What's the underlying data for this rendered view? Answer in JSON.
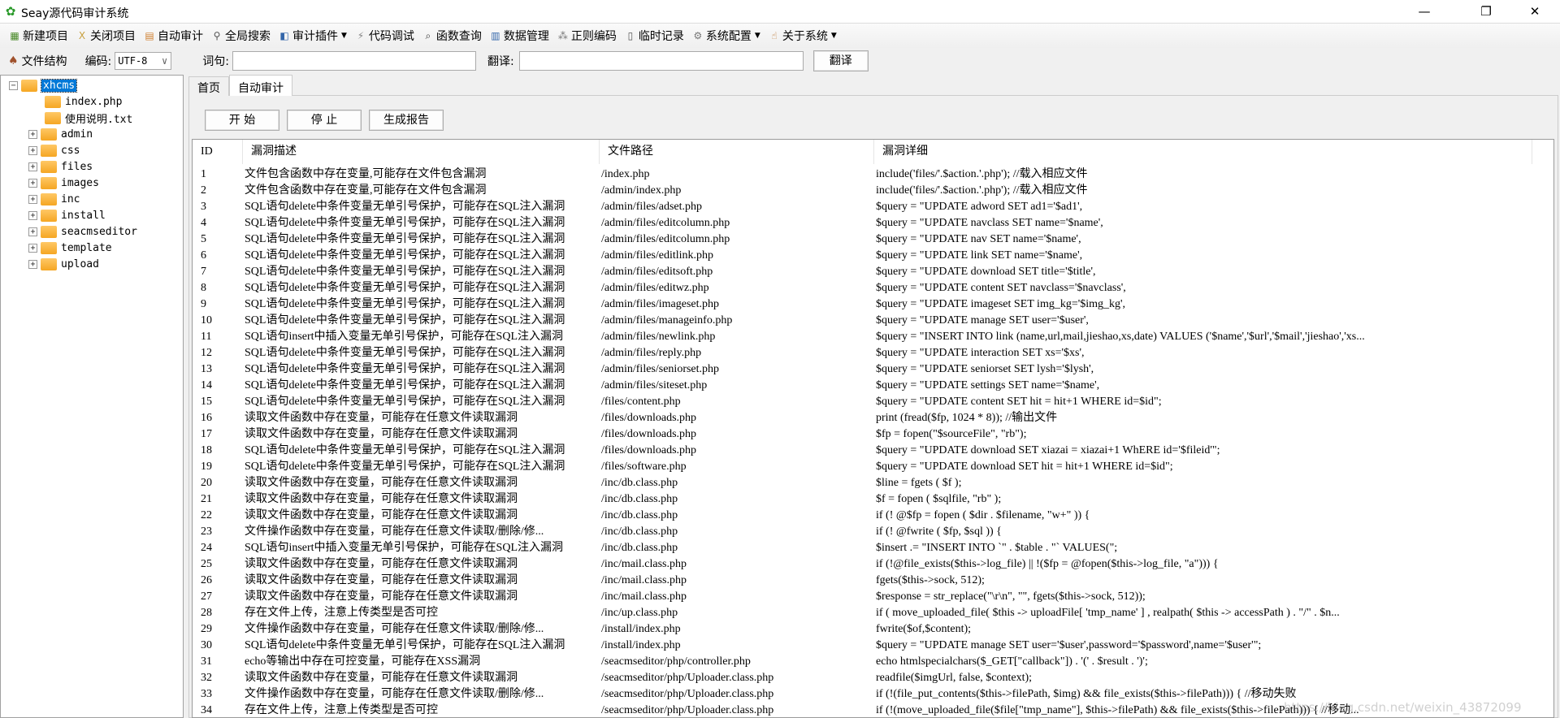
{
  "window": {
    "title": "Seay源代码审计系统",
    "minimize": "—",
    "restore": "❐",
    "close": "✕"
  },
  "toolbar": [
    {
      "label": "新建项目",
      "icon": "new-project-icon",
      "glyph": "▦",
      "color": "#4a8a2a"
    },
    {
      "label": "关闭项目",
      "icon": "close-project-icon",
      "glyph": "X",
      "color": "#c8a040"
    },
    {
      "label": "自动审计",
      "icon": "auto-audit-icon",
      "glyph": "▤",
      "color": "#d08030"
    },
    {
      "label": "全局搜索",
      "icon": "search-icon",
      "glyph": "⚲",
      "color": "#555"
    },
    {
      "label": "审计插件",
      "icon": "plugin-icon",
      "glyph": "◧",
      "color": "#3366aa",
      "dropdown": true
    },
    {
      "label": "代码调试",
      "icon": "debug-icon",
      "glyph": "⚡",
      "color": "#888"
    },
    {
      "label": "函数查询",
      "icon": "function-search-icon",
      "glyph": "⌕",
      "color": "#333"
    },
    {
      "label": "数据管理",
      "icon": "database-icon",
      "glyph": "▥",
      "color": "#3366aa"
    },
    {
      "label": "正则编码",
      "icon": "regex-icon",
      "glyph": "⁂",
      "color": "#777"
    },
    {
      "label": "临时记录",
      "icon": "notes-icon",
      "glyph": "▯",
      "color": "#555"
    },
    {
      "label": "系统配置",
      "icon": "gear-icon",
      "glyph": "⚙",
      "color": "#777",
      "dropdown": true
    },
    {
      "label": "关于系统",
      "icon": "about-icon",
      "glyph": "☝",
      "color": "#c08040",
      "dropdown": true
    }
  ],
  "toolbar2": {
    "file_structure": "文件结构",
    "encoding_label": "编码:",
    "encoding_value": "UTF-8",
    "word_label": "词句:",
    "word_value": "",
    "translate_label": "翻译:",
    "translate_value": "",
    "translate_button": "翻译"
  },
  "tree": {
    "root": "xhcms",
    "files": [
      "index.php",
      "使用说明.txt"
    ],
    "folders": [
      "admin",
      "css",
      "files",
      "images",
      "inc",
      "install",
      "seacmseditor",
      "template",
      "upload"
    ]
  },
  "tabs": [
    {
      "label": "首页",
      "active": false
    },
    {
      "label": "自动审计",
      "active": true
    }
  ],
  "buttons": {
    "start": "开 始",
    "stop": "停 止",
    "report": "生成报告"
  },
  "table": {
    "columns": [
      "ID",
      "漏洞描述",
      "文件路径",
      "漏洞详细"
    ],
    "rows": [
      [
        "1",
        "文件包含函数中存在变量,可能存在文件包含漏洞",
        "/index.php",
        "include('files/'.$action.'.php'); //载入相应文件"
      ],
      [
        "2",
        "文件包含函数中存在变量,可能存在文件包含漏洞",
        "/admin/index.php",
        "include('files/'.$action.'.php'); //载入相应文件"
      ],
      [
        "3",
        "SQL语句delete中条件变量无单引号保护，可能存在SQL注入漏洞",
        "/admin/files/adset.php",
        "$query = \"UPDATE adword SET ad1='$ad1',"
      ],
      [
        "4",
        "SQL语句delete中条件变量无单引号保护，可能存在SQL注入漏洞",
        "/admin/files/editcolumn.php",
        "$query = \"UPDATE navclass SET name='$name',"
      ],
      [
        "5",
        "SQL语句delete中条件变量无单引号保护，可能存在SQL注入漏洞",
        "/admin/files/editcolumn.php",
        "$query = \"UPDATE nav SET name='$name',"
      ],
      [
        "6",
        "SQL语句delete中条件变量无单引号保护，可能存在SQL注入漏洞",
        "/admin/files/editlink.php",
        "$query = \"UPDATE link SET name='$name',"
      ],
      [
        "7",
        "SQL语句delete中条件变量无单引号保护，可能存在SQL注入漏洞",
        "/admin/files/editsoft.php",
        "$query = \"UPDATE download SET title='$title',"
      ],
      [
        "8",
        "SQL语句delete中条件变量无单引号保护，可能存在SQL注入漏洞",
        "/admin/files/editwz.php",
        "$query = \"UPDATE content SET navclass='$navclass',"
      ],
      [
        "9",
        "SQL语句delete中条件变量无单引号保护，可能存在SQL注入漏洞",
        "/admin/files/imageset.php",
        "$query = \"UPDATE imageset SET img_kg='$img_kg',"
      ],
      [
        "10",
        "SQL语句delete中条件变量无单引号保护，可能存在SQL注入漏洞",
        "/admin/files/manageinfo.php",
        "$query = \"UPDATE manage SET user='$user',"
      ],
      [
        "11",
        "SQL语句insert中插入变量无单引号保护，可能存在SQL注入漏洞",
        "/admin/files/newlink.php",
        "$query = \"INSERT INTO link (name,url,mail,jieshao,xs,date) VALUES ('$name','$url','$mail','jieshao','xs..."
      ],
      [
        "12",
        "SQL语句delete中条件变量无单引号保护，可能存在SQL注入漏洞",
        "/admin/files/reply.php",
        "$query = \"UPDATE interaction SET xs='$xs',"
      ],
      [
        "13",
        "SQL语句delete中条件变量无单引号保护，可能存在SQL注入漏洞",
        "/admin/files/seniorset.php",
        "$query = \"UPDATE seniorset SET lysh='$lysh',"
      ],
      [
        "14",
        "SQL语句delete中条件变量无单引号保护，可能存在SQL注入漏洞",
        "/admin/files/siteset.php",
        "$query = \"UPDATE settings SET name='$name',"
      ],
      [
        "15",
        "SQL语句delete中条件变量无单引号保护，可能存在SQL注入漏洞",
        "/files/content.php",
        "$query = \"UPDATE content SET hit = hit+1 WHERE id=$id\";"
      ],
      [
        "16",
        "读取文件函数中存在变量，可能存在任意文件读取漏洞",
        "/files/downloads.php",
        "print (fread($fp, 1024 * 8)); //输出文件"
      ],
      [
        "17",
        "读取文件函数中存在变量，可能存在任意文件读取漏洞",
        "/files/downloads.php",
        "$fp = fopen(\"$sourceFile\", \"rb\");"
      ],
      [
        "18",
        "SQL语句delete中条件变量无单引号保护，可能存在SQL注入漏洞",
        "/files/downloads.php",
        "$query = \"UPDATE download SET xiazai = xiazai+1 WhERE id='$fileid'\";"
      ],
      [
        "19",
        "SQL语句delete中条件变量无单引号保护，可能存在SQL注入漏洞",
        "/files/software.php",
        "$query = \"UPDATE download SET hit = hit+1 WHERE id=$id\";"
      ],
      [
        "20",
        "读取文件函数中存在变量，可能存在任意文件读取漏洞",
        "/inc/db.class.php",
        "$line = fgets ( $f );"
      ],
      [
        "21",
        "读取文件函数中存在变量，可能存在任意文件读取漏洞",
        "/inc/db.class.php",
        "$f = fopen ( $sqlfile, \"rb\" );"
      ],
      [
        "22",
        "读取文件函数中存在变量，可能存在任意文件读取漏洞",
        "/inc/db.class.php",
        "if (! @$fp = fopen ( $dir . $filename, \"w+\" )) {"
      ],
      [
        "23",
        "文件操作函数中存在变量，可能存在任意文件读取/删除/修...",
        "/inc/db.class.php",
        "if (! @fwrite ( $fp, $sql )) {"
      ],
      [
        "24",
        "SQL语句insert中插入变量无单引号保护，可能存在SQL注入漏洞",
        "/inc/db.class.php",
        "$insert .= \"INSERT INTO `\" . $table . \"` VALUES(\";"
      ],
      [
        "25",
        "读取文件函数中存在变量，可能存在任意文件读取漏洞",
        "/inc/mail.class.php",
        "if (!@file_exists($this->log_file) || !($fp = @fopen($this->log_file, \"a\"))) {"
      ],
      [
        "26",
        "读取文件函数中存在变量，可能存在任意文件读取漏洞",
        "/inc/mail.class.php",
        "fgets($this->sock, 512);"
      ],
      [
        "27",
        "读取文件函数中存在变量，可能存在任意文件读取漏洞",
        "/inc/mail.class.php",
        "$response = str_replace(\"\\r\\n\", \"\", fgets($this->sock, 512));"
      ],
      [
        "28",
        "存在文件上传，注意上传类型是否可控",
        "/inc/up.class.php",
        "if ( move_uploaded_file( $this -> uploadFile[ 'tmp_name' ] , realpath( $this -> accessPath ) . \"/\" . $n..."
      ],
      [
        "29",
        "文件操作函数中存在变量，可能存在任意文件读取/删除/修...",
        "/install/index.php",
        "fwrite($of,$content);"
      ],
      [
        "30",
        "SQL语句delete中条件变量无单引号保护，可能存在SQL注入漏洞",
        "/install/index.php",
        "$query = \"UPDATE manage SET user='$user',password='$password',name='$user'\";"
      ],
      [
        "31",
        "echo等输出中存在可控变量，可能存在XSS漏洞",
        "/seacmseditor/php/controller.php",
        "echo htmlspecialchars($_GET[\"callback\"]) . '(' . $result . ')';"
      ],
      [
        "32",
        "读取文件函数中存在变量，可能存在任意文件读取漏洞",
        "/seacmseditor/php/Uploader.class.php",
        "readfile($imgUrl, false, $context);"
      ],
      [
        "33",
        "文件操作函数中存在变量，可能存在任意文件读取/删除/修...",
        "/seacmseditor/php/Uploader.class.php",
        "if (!(file_put_contents($this->filePath, $img) && file_exists($this->filePath))) { //移动失败"
      ],
      [
        "34",
        "存在文件上传，注意上传类型是否可控",
        "/seacmseditor/php/Uploader.class.php",
        "if (!(move_uploaded_file($file[\"tmp_name\"], $this->filePath) && file_exists($this->filePath))) { //移动..."
      ]
    ]
  },
  "watermark": "https://blog.csdn.net/weixin_43872099",
  "colors": {
    "selection": "#0078d7",
    "folder": "#f5a623"
  }
}
